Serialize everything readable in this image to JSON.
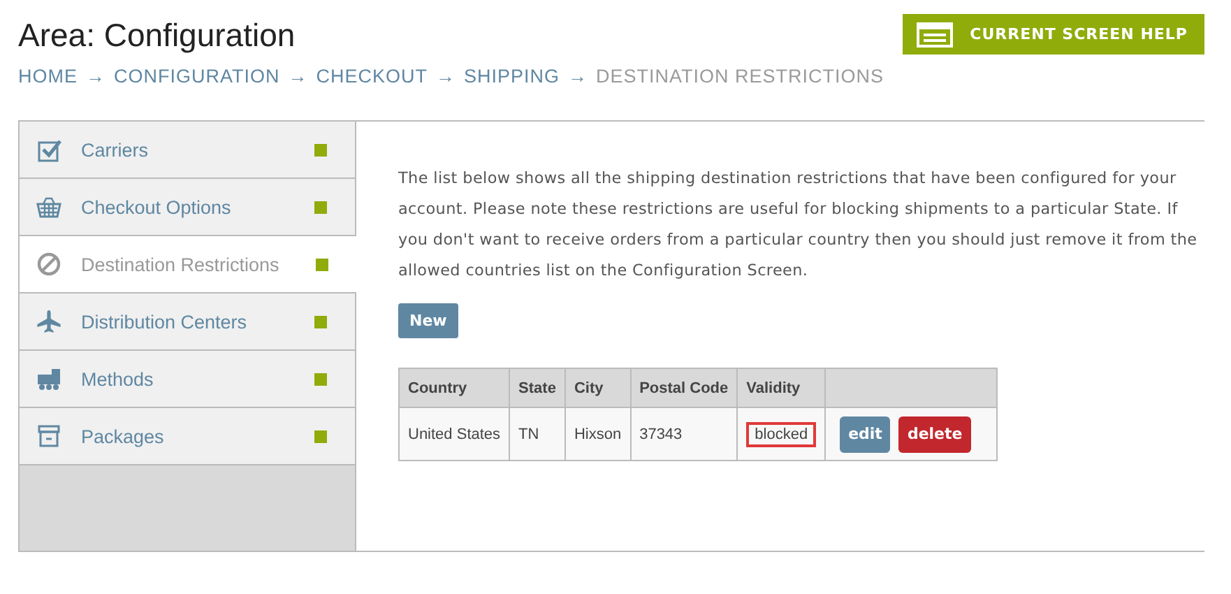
{
  "header": {
    "title": "Area: Configuration",
    "help_button": "CURRENT SCREEN HELP"
  },
  "breadcrumb": [
    {
      "label": "HOME",
      "current": false
    },
    {
      "label": "CONFIGURATION",
      "current": false
    },
    {
      "label": "CHECKOUT",
      "current": false
    },
    {
      "label": "SHIPPING",
      "current": false
    },
    {
      "label": "DESTINATION RESTRICTIONS",
      "current": true
    }
  ],
  "breadcrumb_separator": "→",
  "sidebar": {
    "items": [
      {
        "label": "Carriers",
        "kind": "check",
        "selected": false
      },
      {
        "label": "Checkout Options",
        "kind": "basket",
        "selected": false
      },
      {
        "label": "Destination Restrictions",
        "kind": "ban",
        "selected": true
      },
      {
        "label": "Distribution Centers",
        "kind": "plane",
        "selected": false
      },
      {
        "label": "Methods",
        "kind": "truck",
        "selected": false
      },
      {
        "label": "Packages",
        "kind": "box",
        "selected": false
      }
    ]
  },
  "content": {
    "description": "The list below shows all the shipping destination restrictions that have been configured for your account. Please note these restrictions are useful for blocking shipments to a particular State. If you don't want to receive orders from a particular country then you should just remove it from the allowed countries list on the Configuration Screen.",
    "new_button": "New",
    "table": {
      "columns": [
        "Country",
        "State",
        "City",
        "Postal Code",
        "Validity"
      ],
      "rows": [
        {
          "cells": [
            {
              "text": "United States",
              "highlighted": false
            },
            {
              "text": "TN",
              "highlighted": false
            },
            {
              "text": "Hixson",
              "highlighted": false
            },
            {
              "text": "37343",
              "highlighted": false
            },
            {
              "text": "blocked",
              "highlighted": true
            }
          ],
          "edit_button": "edit",
          "delete_button": "delete"
        }
      ]
    }
  }
}
